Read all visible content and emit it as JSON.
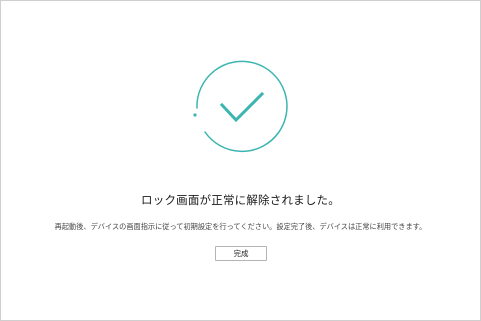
{
  "dialog": {
    "title": "ロック画面が正常に解除されました。",
    "instruction": "再起動後、デバイスの画面指示に従って初期設定を行ってください。設定完了後、デバイスは正常に利用できます。",
    "done_button_label": "完成"
  },
  "icon": {
    "name": "checkmark-circle-icon",
    "accent_color": "#3bb5b0"
  }
}
